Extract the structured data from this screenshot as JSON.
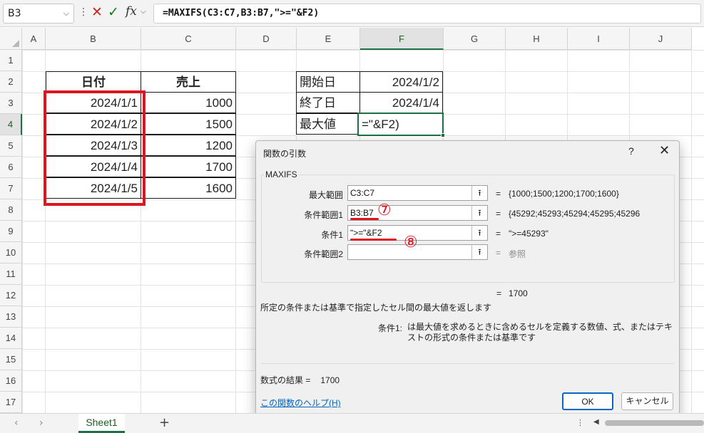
{
  "formula_bar": {
    "name_box": "B3",
    "formula": "=MAXIFS(C3:C7,B3:B7,\">=\"&F2)"
  },
  "columns": [
    "A",
    "B",
    "C",
    "D",
    "E",
    "F",
    "G",
    "H",
    "I",
    "J"
  ],
  "rows": [
    "1",
    "2",
    "3",
    "4",
    "5",
    "6",
    "7",
    "8",
    "9",
    "10",
    "11",
    "12",
    "13",
    "14",
    "15",
    "16",
    "17"
  ],
  "table": {
    "headers": [
      "日付",
      "売上"
    ],
    "rows": [
      {
        "date": "2024/1/1",
        "sales": "1000"
      },
      {
        "date": "2024/1/2",
        "sales": "1500"
      },
      {
        "date": "2024/1/3",
        "sales": "1200"
      },
      {
        "date": "2024/1/4",
        "sales": "1700"
      },
      {
        "date": "2024/1/5",
        "sales": "1600"
      }
    ]
  },
  "criteria_table": {
    "start_label": "開始日",
    "start_value": "2024/1/2",
    "end_label": "終了日",
    "end_value": "2024/1/4",
    "max_label": "最大値",
    "max_value": "=\"&F2)"
  },
  "dialog": {
    "title": "関数の引数",
    "help_glyph": "?",
    "close_glyph": "✕",
    "function_name": "MAXIFS",
    "args": [
      {
        "label": "最大範囲",
        "value": "C3:C7",
        "result": "{1000;1500;1200;1700;1600}"
      },
      {
        "label": "条件範囲1",
        "value": "B3:B7",
        "result": "{45292;45293;45294;45295;45296"
      },
      {
        "label": "条件1",
        "value": "\">=\"&F2",
        "result": "\">=45293\""
      },
      {
        "label": "条件範囲2",
        "value": "",
        "result": "参照"
      }
    ],
    "equals": "=",
    "total": "1700",
    "description": "所定の条件または基準で指定したセル間の最大値を返します",
    "arg_desc_name": "条件1:",
    "arg_desc_text": "は最大値を求めるときに含めるセルを定義する数値、式、またはテキストの形式の条件または基準です",
    "result_label": "数式の結果 =",
    "result_value": "1700",
    "help_link": "この関数のヘルプ(H)",
    "ok_label": "OK",
    "cancel_label": "キャンセル"
  },
  "annotations": {
    "marker7": "⑦",
    "marker8": "⑧",
    "color": "#e0141e"
  },
  "sheet_tabs": {
    "active": "Sheet1",
    "add_glyph": "+"
  }
}
